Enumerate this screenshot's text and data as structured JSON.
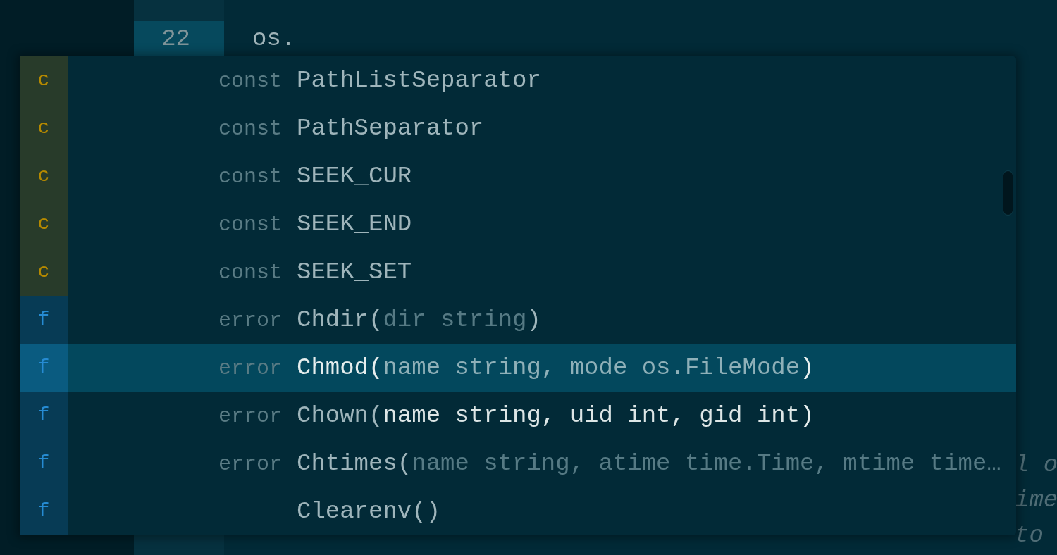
{
  "editor": {
    "top_lines": [
      {
        "kind": "code",
        "number": "22",
        "code": "os.",
        "current": true
      }
    ],
    "bottom_lines": [
      {
        "kind": "tail",
        "code": "l o"
      },
      {
        "kind": "tail",
        "code": "ime"
      },
      {
        "kind": "tail",
        "code": "to"
      }
    ]
  },
  "autocomplete": {
    "items": [
      {
        "kind": "const",
        "letter": "c",
        "type": "const",
        "name": "PathListSeparator",
        "selected": false
      },
      {
        "kind": "const",
        "letter": "c",
        "type": "const",
        "name": "PathSeparator",
        "selected": false
      },
      {
        "kind": "const",
        "letter": "c",
        "type": "const",
        "name": "SEEK_CUR",
        "selected": false
      },
      {
        "kind": "const",
        "letter": "c",
        "type": "const",
        "name": "SEEK_END",
        "selected": false
      },
      {
        "kind": "const",
        "letter": "c",
        "type": "const",
        "name": "SEEK_SET",
        "selected": false
      },
      {
        "kind": "func",
        "letter": "f",
        "type": "error",
        "name": "Chdir(",
        "params": "dir string",
        "params_dimmed": true,
        "params_emphasized": false,
        "close": ")",
        "selected": false
      },
      {
        "kind": "func",
        "letter": "f",
        "type": "error",
        "name": "Chmod(",
        "params": "name string, mode os.FileMode",
        "params_dimmed": false,
        "params_emphasized": false,
        "close": ")",
        "selected": true
      },
      {
        "kind": "func",
        "letter": "f",
        "type": "error",
        "name": "Chown(",
        "params": "name string, uid int, gid int",
        "params_dimmed": false,
        "params_emphasized": true,
        "close": ")",
        "selected": false
      },
      {
        "kind": "func",
        "letter": "f",
        "type": "error",
        "name": "Chtimes(",
        "params": "name string, atime time.Time, mtime time…",
        "params_dimmed": true,
        "params_emphasized": false,
        "selected": false
      },
      {
        "kind": "func",
        "letter": "f",
        "name": "Clearenv()",
        "selected": false
      }
    ]
  }
}
